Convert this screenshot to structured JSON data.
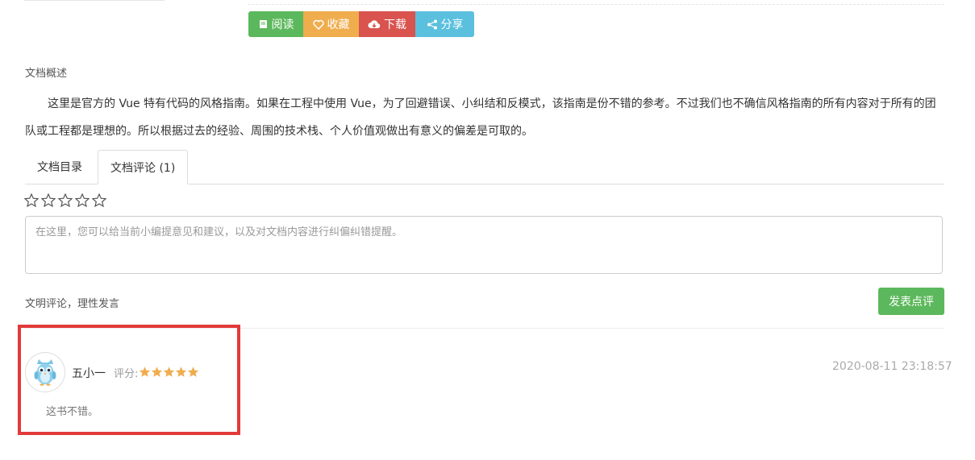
{
  "actions": {
    "read_label": "阅读",
    "favorite_label": "收藏",
    "download_label": "下载",
    "share_label": "分享"
  },
  "summary": {
    "label": "文档概述",
    "text": "这里是官方的 Vue 特有代码的风格指南。如果在工程中使用 Vue，为了回避错误、小纠结和反模式，该指南是份不错的参考。不过我们也不确信风格指南的所有内容对于所有的团队或工程都是理想的。所以根据过去的经验、周围的技术栈、个人价值观做出有意义的偏差是可取的。"
  },
  "tabs": {
    "toc": "文档目录",
    "comments": "文档评论 (1)"
  },
  "comment_form": {
    "rating_value": 0,
    "rating_max": 5,
    "placeholder": "在这里，您可以给当前小编提意见和建议，以及对文档内容进行纠偏纠错提醒。",
    "civil_notice": "文明评论，理性发言",
    "submit_label": "发表点评"
  },
  "reviews": [
    {
      "name": "五小一",
      "rating_label": "评分:",
      "rating": 5,
      "time": "2020-08-11 23:18:57",
      "text": "这书不错。"
    }
  ],
  "colors": {
    "green": "#5cb85c",
    "orange": "#f0ad4e",
    "red": "#d9534f",
    "blue": "#5bc0de",
    "star": "#f0ad4e",
    "highlight": "#e23a3a"
  }
}
